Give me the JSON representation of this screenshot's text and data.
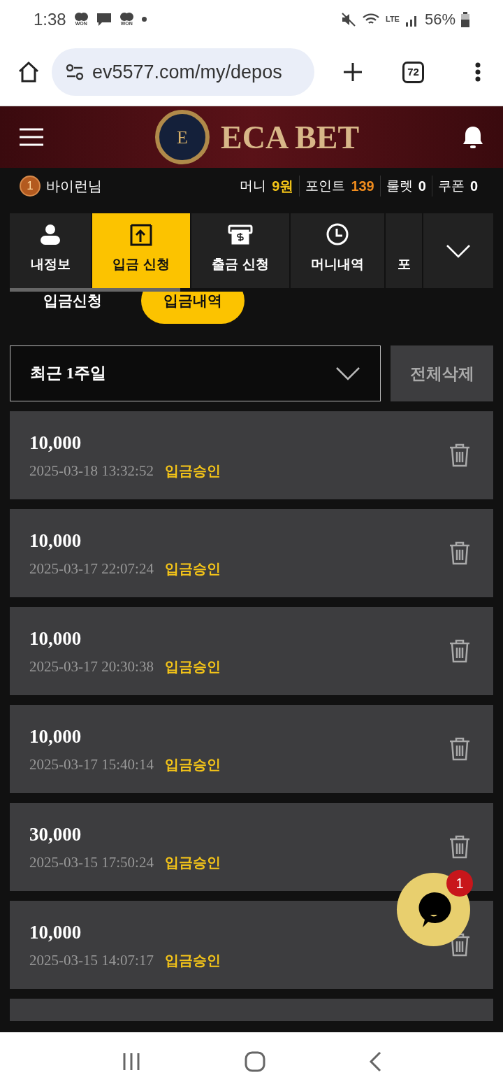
{
  "status_bar": {
    "time": "1:38",
    "notifications": [
      {
        "kind": "won",
        "label": "WON"
      },
      {
        "kind": "message"
      },
      {
        "kind": "won",
        "label": "WON"
      },
      {
        "kind": "dot"
      }
    ],
    "network": "LTE",
    "battery": "56%"
  },
  "browser": {
    "url": "ev5577.com/my/depos",
    "tab_count": "72"
  },
  "header": {
    "emblem_letter": "E",
    "brand": "ECA BET"
  },
  "user": {
    "level": "1",
    "name": "바이런님",
    "stats": [
      {
        "label": "머니",
        "value": "9원",
        "color": "#f5c518"
      },
      {
        "label": "포인트",
        "value": "139",
        "color": "#f08c1e"
      },
      {
        "label": "룰렛",
        "value": "0",
        "color": "#ffffff"
      },
      {
        "label": "쿠폰",
        "value": "0",
        "color": "#ffffff"
      }
    ]
  },
  "tabs": [
    {
      "kind": "person",
      "label": "내정보",
      "selected": false
    },
    {
      "kind": "deposit",
      "label": "입금 신청",
      "selected": true
    },
    {
      "kind": "withdraw",
      "label": "출금 신청",
      "selected": false
    },
    {
      "kind": "clock",
      "label": "머니내역",
      "selected": false
    },
    {
      "kind": "cut",
      "label": "포",
      "selected": false
    }
  ],
  "subtabs": [
    {
      "label": "입금신청",
      "selected": false
    },
    {
      "label": "입금내역",
      "selected": true
    }
  ],
  "filter": {
    "period": "최근 1주일",
    "delete_all": "전체삭제"
  },
  "records": [
    {
      "amount": "10,000",
      "datetime": "2025-03-18 13:32:52",
      "status": "입금승인"
    },
    {
      "amount": "10,000",
      "datetime": "2025-03-17 22:07:24",
      "status": "입금승인"
    },
    {
      "amount": "10,000",
      "datetime": "2025-03-17 20:30:38",
      "status": "입금승인"
    },
    {
      "amount": "10,000",
      "datetime": "2025-03-17 15:40:14",
      "status": "입금승인"
    },
    {
      "amount": "30,000",
      "datetime": "2025-03-15 17:50:24",
      "status": "입금승인"
    },
    {
      "amount": "10,000",
      "datetime": "2025-03-15 14:07:17",
      "status": "입금승인"
    }
  ],
  "chat": {
    "badge": "1"
  }
}
